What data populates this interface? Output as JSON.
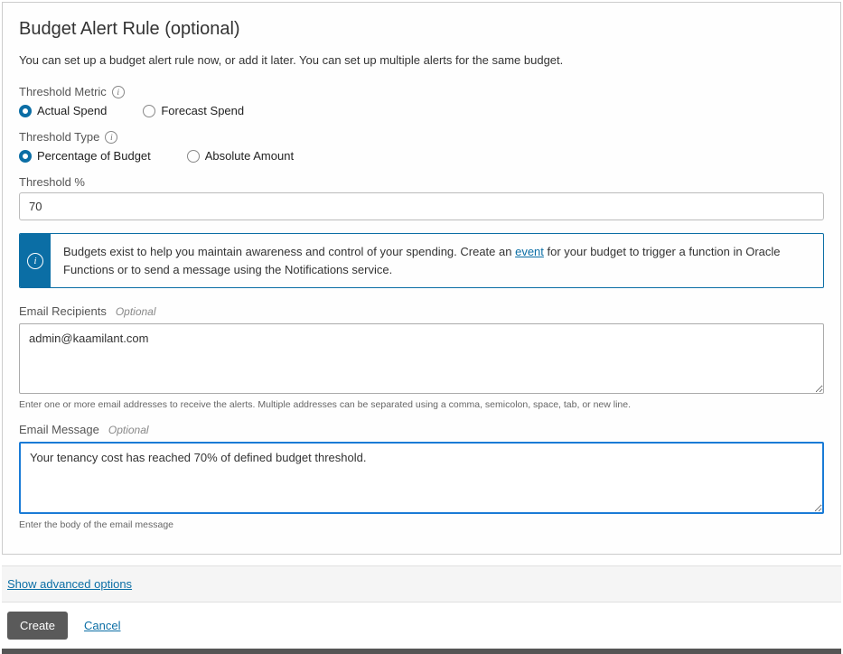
{
  "panel": {
    "title": "Budget Alert Rule (optional)",
    "description": "You can set up a budget alert rule now, or add it later. You can set up multiple alerts for the same budget."
  },
  "threshold_metric": {
    "label": "Threshold Metric",
    "options": {
      "actual": "Actual Spend",
      "forecast": "Forecast Spend"
    },
    "selected": "actual"
  },
  "threshold_type": {
    "label": "Threshold Type",
    "options": {
      "percentage": "Percentage of Budget",
      "absolute": "Absolute Amount"
    },
    "selected": "percentage"
  },
  "threshold_percent": {
    "label": "Threshold %",
    "value": "70"
  },
  "info_banner": {
    "text_before": "Budgets exist to help you maintain awareness and control of your spending. Create an ",
    "link_text": "event",
    "text_after": " for your budget to trigger a function in Oracle Functions or to send a message using the Notifications service."
  },
  "email_recipients": {
    "label": "Email Recipients",
    "optional": "Optional",
    "value": "admin@kaamilant.com",
    "help": "Enter one or more email addresses to receive the alerts. Multiple addresses can be separated using a comma, semicolon, space, tab, or new line."
  },
  "email_message": {
    "label": "Email Message",
    "optional": "Optional",
    "value": "Your tenancy cost has reached 70% of defined budget threshold.",
    "help": "Enter the body of the email message"
  },
  "advanced_link": "Show advanced options",
  "buttons": {
    "create": "Create",
    "cancel": "Cancel"
  }
}
